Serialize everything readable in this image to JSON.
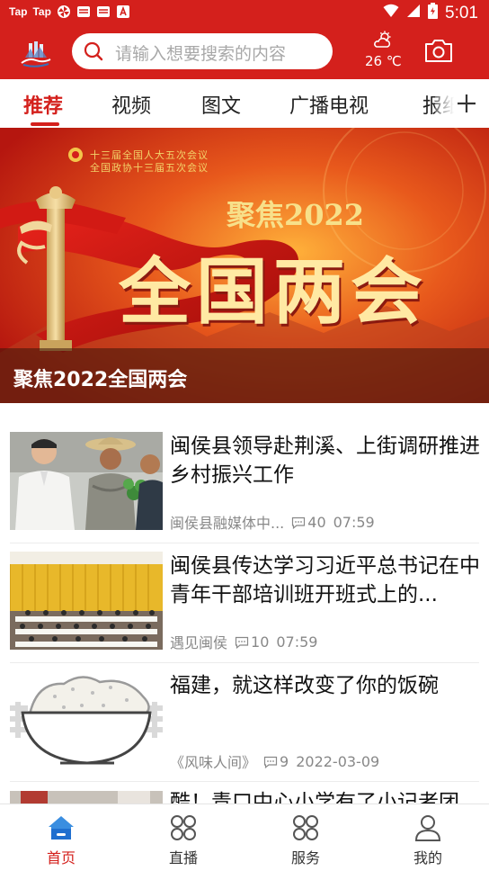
{
  "status_bar": {
    "apps": [
      "Tap",
      "Tap"
    ],
    "time": "5:01"
  },
  "header": {
    "search_placeholder": "请输入想要搜索的内容",
    "weather_temp": "26 ℃"
  },
  "tabs": [
    {
      "label": "推荐",
      "active": true
    },
    {
      "label": "视频",
      "active": false
    },
    {
      "label": "图文",
      "active": false
    },
    {
      "label": "广播电视",
      "active": false
    },
    {
      "label": "报纸",
      "active": false
    }
  ],
  "banner": {
    "line1": "十三届全国人大五次会议",
    "line2": "全国政协十三届五次会议",
    "focus": "聚焦2022",
    "headline": "全国两会",
    "caption": "聚焦2022全国两会"
  },
  "news": [
    {
      "title": "闽侯县领导赴荆溪、上街调研推进乡村振兴工作",
      "source": "闽侯县融媒体中...",
      "comments": "40",
      "time": "07:59",
      "thumb": "people-photo"
    },
    {
      "title": "闽侯县传达学习习近平总书记在中青年干部培训班开班式上的...",
      "source": "遇见闽侯",
      "comments": "10",
      "time": "07:59",
      "thumb": "meeting-photo"
    },
    {
      "title": "福建，就这样改变了你的饭碗",
      "source": "《风味人间》",
      "comments": "9",
      "time": "2022-03-09",
      "thumb": "rice-bowl-illustration"
    },
    {
      "title": "酷！青口中心小学有了小记者团",
      "thumb": "classroom-photo"
    }
  ],
  "bottom_nav": [
    {
      "label": "首页",
      "icon": "home-icon",
      "active": true
    },
    {
      "label": "直播",
      "icon": "live-grid-icon",
      "active": false
    },
    {
      "label": "服务",
      "icon": "service-grid-icon",
      "active": false
    },
    {
      "label": "我的",
      "icon": "profile-icon",
      "active": false
    }
  ],
  "colors": {
    "brand_red": "#d4201c",
    "text_dark": "#111111",
    "meta_gray": "#888888"
  }
}
